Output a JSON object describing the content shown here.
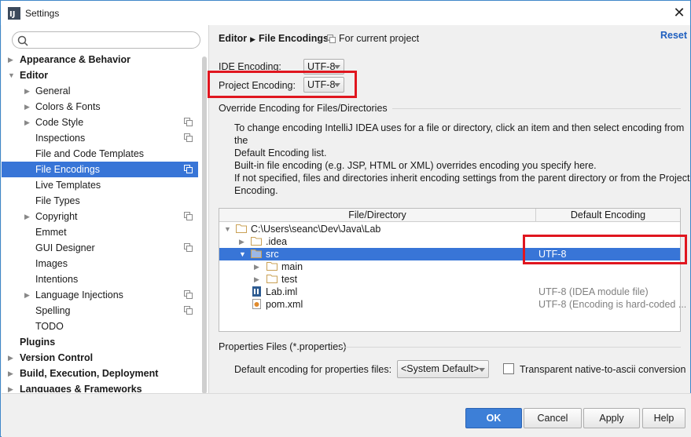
{
  "window": {
    "title": "Settings",
    "close": "✕"
  },
  "sidebar": {
    "search_placeholder": "",
    "items": [
      {
        "label": "Appearance & Behavior"
      },
      {
        "label": "Editor"
      },
      {
        "label": "General"
      },
      {
        "label": "Colors & Fonts"
      },
      {
        "label": "Code Style"
      },
      {
        "label": "Inspections"
      },
      {
        "label": "File and Code Templates"
      },
      {
        "label": "File Encodings"
      },
      {
        "label": "Live Templates"
      },
      {
        "label": "File Types"
      },
      {
        "label": "Copyright"
      },
      {
        "label": "Emmet"
      },
      {
        "label": "GUI Designer"
      },
      {
        "label": "Images"
      },
      {
        "label": "Intentions"
      },
      {
        "label": "Language Injections"
      },
      {
        "label": "Spelling"
      },
      {
        "label": "TODO"
      },
      {
        "label": "Plugins"
      },
      {
        "label": "Version Control"
      },
      {
        "label": "Build, Execution, Deployment"
      },
      {
        "label": "Languages & Frameworks"
      }
    ]
  },
  "header": {
    "crumb1": "Editor",
    "crumb_sep": "▶",
    "crumb2": "File Encodings",
    "for_project": "For current project",
    "reset": "Reset"
  },
  "encoding": {
    "ide_label": "IDE Encoding:",
    "ide_value": "UTF-8",
    "project_label": "Project Encoding:",
    "project_value": "UTF-8"
  },
  "override": {
    "title": "Override Encoding for Files/Directories",
    "para1_line1": "To change encoding IntelliJ IDEA uses for a file or directory, click an item and then select encoding from the",
    "para1_line2": "Default Encoding list.",
    "para2_line1": "Built-in file encoding (e.g. JSP, HTML or XML) overrides encoding you specify here.",
    "para2_line2": "If not specified, files and directories inherit encoding settings from the parent directory or from the Project",
    "para2_line3": "Encoding."
  },
  "table": {
    "col1": "File/Directory",
    "col2": "Default Encoding",
    "rows": [
      {
        "name": "C:\\Users\\seanc\\Dev\\Java\\Lab",
        "enc": ""
      },
      {
        "name": ".idea",
        "enc": ""
      },
      {
        "name": "src",
        "enc": "UTF-8"
      },
      {
        "name": "main",
        "enc": ""
      },
      {
        "name": "test",
        "enc": ""
      },
      {
        "name": "Lab.iml",
        "enc": "UTF-8 (IDEA module file)"
      },
      {
        "name": "pom.xml",
        "enc": "UTF-8 (Encoding is hard-coded ..."
      }
    ]
  },
  "properties": {
    "title": "Properties Files (*.properties)",
    "default_label": "Default encoding for properties files:",
    "default_value": "<System Default>",
    "transparent_label": "Transparent native-to-ascii conversion"
  },
  "buttons": {
    "ok": "OK",
    "cancel": "Cancel",
    "apply": "Apply",
    "help": "Help"
  },
  "colors": {
    "selection": "#3875d7",
    "highlight": "#e0161f",
    "link": "#1f5fbf",
    "folder": "#c9a054"
  }
}
